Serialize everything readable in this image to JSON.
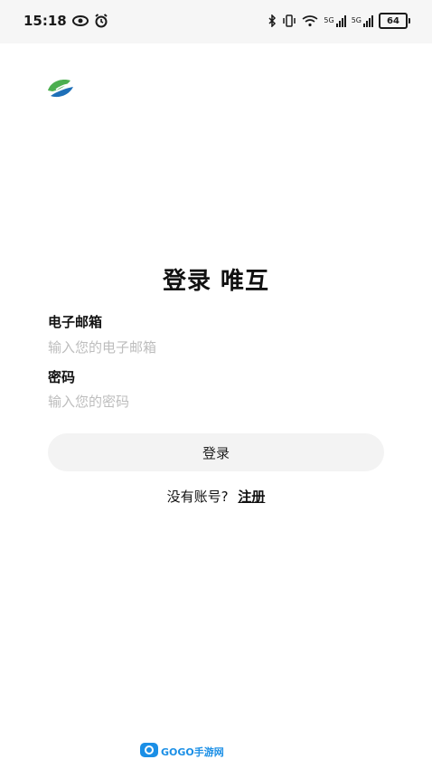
{
  "status_bar": {
    "time": "15:18",
    "battery": "64",
    "signal_tag_1": "5G",
    "signal_tag_2": "5G",
    "icons": [
      "eye-icon",
      "alarm-icon",
      "bluetooth-icon",
      "vibrate-icon",
      "wifi-icon",
      "signal-icon",
      "battery-icon"
    ]
  },
  "app": {
    "logo": "leaf-logo",
    "title": "登录 唯互"
  },
  "form": {
    "email_label": "电子邮箱",
    "email_placeholder": "输入您的电子邮箱",
    "password_label": "密码",
    "password_placeholder": "输入您的密码",
    "login_label": "登录"
  },
  "register": {
    "prompt": "没有账号?",
    "link": "注册"
  },
  "watermark": {
    "text": "GOGO手游网"
  },
  "colors": {
    "button_bg": "#f3f3f3",
    "placeholder": "#bdbdbd",
    "logo_green": "#4caf50",
    "logo_blue": "#1e6fb8",
    "watermark_blue": "#1b8fe6"
  }
}
